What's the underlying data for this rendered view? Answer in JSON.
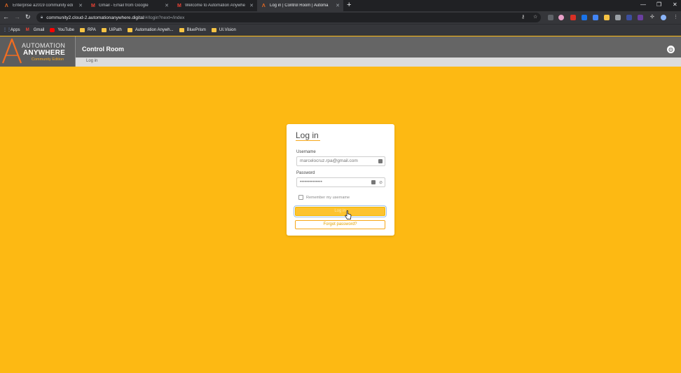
{
  "browser": {
    "tabs": [
      {
        "title": "Enterprise a2019 community edi",
        "icon": "automation-anywhere-icon",
        "active": false
      },
      {
        "title": "Gmail - Email from Google",
        "icon": "gmail-icon",
        "active": false
      },
      {
        "title": "Welcome to Automation Anywhe",
        "icon": "gmail-icon",
        "active": false
      },
      {
        "title": "Log in | Control Room | Automa",
        "icon": "automation-anywhere-icon",
        "active": true
      }
    ],
    "url_host": "community2.cloud-2.automationanywhere.digital",
    "url_path": "/#/login?next=/index",
    "bookmarks": [
      {
        "label": "Apps",
        "icon": "apps-icon"
      },
      {
        "label": "Gmail",
        "icon": "gmail-icon"
      },
      {
        "label": "YouTube",
        "icon": "youtube-icon"
      },
      {
        "label": "RPA",
        "icon": "folder-icon"
      },
      {
        "label": "UiPath",
        "icon": "folder-icon"
      },
      {
        "label": "Automation Anywh...",
        "icon": "folder-icon"
      },
      {
        "label": "BluePrism",
        "icon": "folder-icon"
      },
      {
        "label": "UI.Vision",
        "icon": "folder-icon"
      }
    ]
  },
  "app": {
    "logo_line1": "AUTOMATION",
    "logo_line2": "ANYWHERE",
    "logo_line3": "Community Edition",
    "title": "Control Room",
    "breadcrumb": "Log in",
    "colors": {
      "accent": "#fdb913",
      "header": "#656565",
      "logo_orange": "#f26d21"
    }
  },
  "login": {
    "heading": "Log in",
    "username_label": "Username",
    "username_value": "marcelocruz.rpa@gmail.com",
    "password_label": "Password",
    "password_value": "••••••••••••••",
    "remember_label": "Remember my username",
    "login_button": "Log in",
    "forgot_button": "Forgot password?"
  }
}
